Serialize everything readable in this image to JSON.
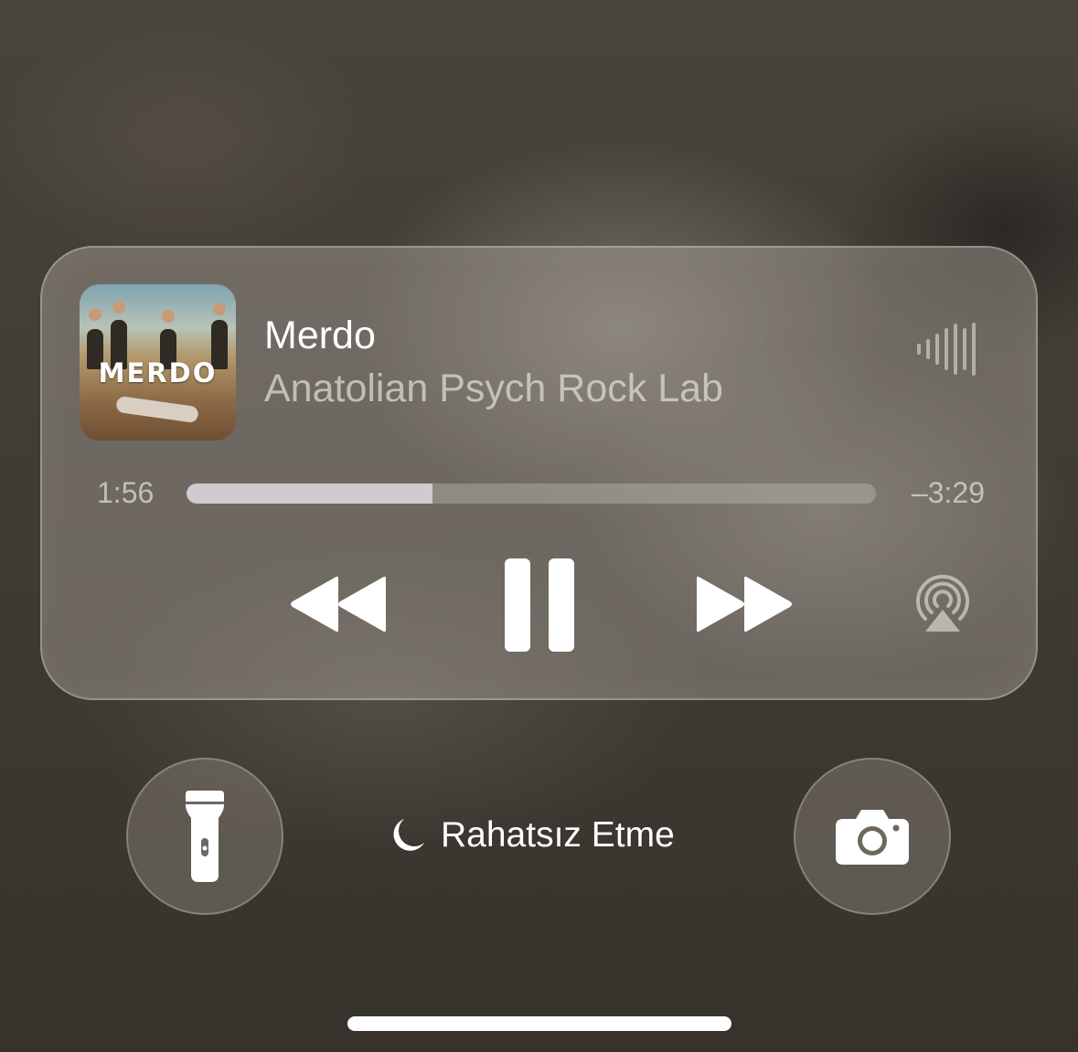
{
  "now_playing": {
    "album_art_text": "MERDO",
    "title": "Merdo",
    "artist": "Anatolian Psych Rock Lab",
    "elapsed": "1:56",
    "remaining": "–3:29",
    "progress_fraction": 0.357,
    "icons": {
      "waveform": "audio-waveform-icon",
      "rewind": "rewind-icon",
      "pause": "pause-icon",
      "forward": "fast-forward-icon",
      "airplay": "airplay-icon"
    }
  },
  "lock_controls": {
    "flashlight_icon": "flashlight-icon",
    "camera_icon": "camera-icon",
    "focus_icon": "moon-icon",
    "focus_label": "Rahatsız Etme"
  }
}
